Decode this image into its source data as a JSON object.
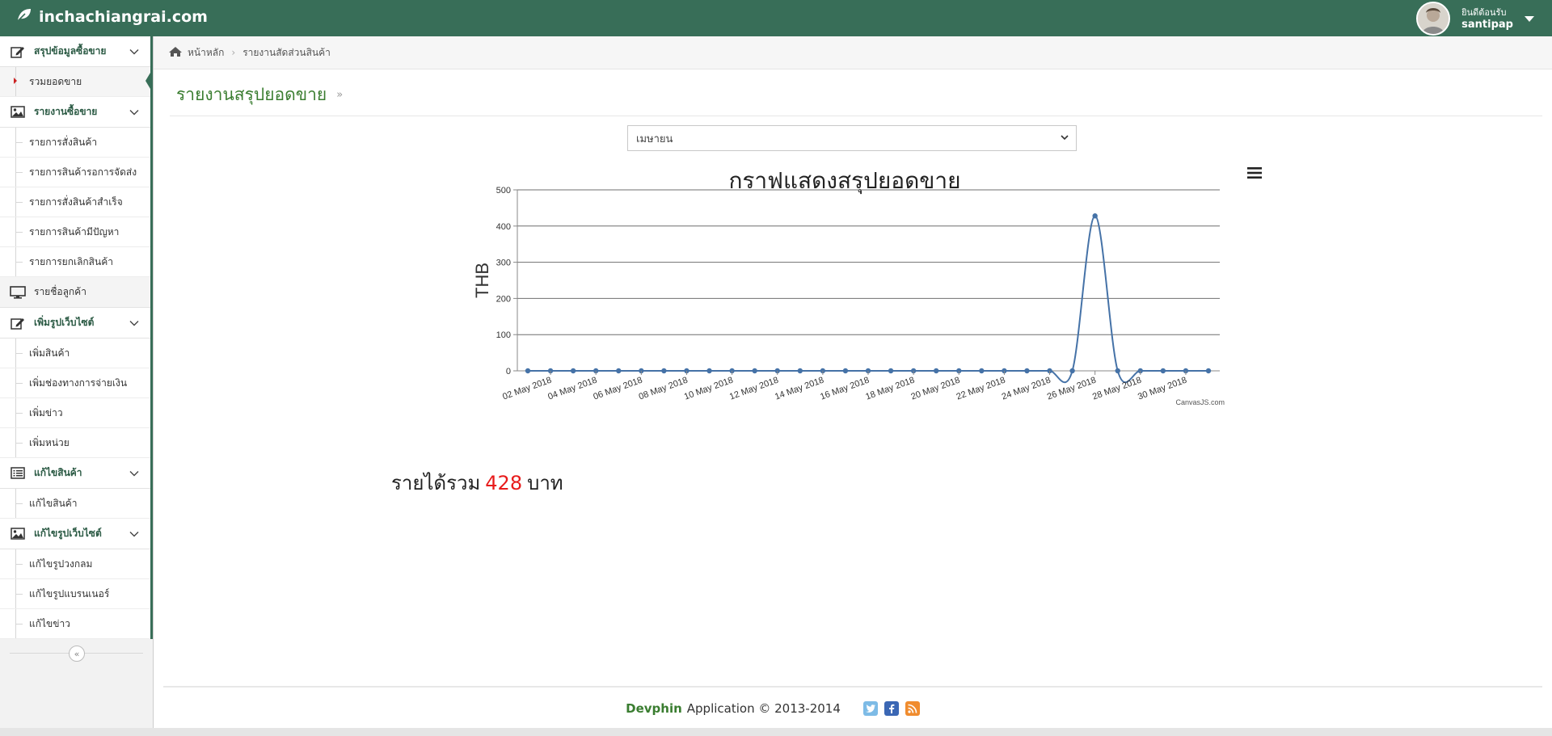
{
  "topbar": {
    "brand": "inchachiangrai.com",
    "welcome": "ยินดีต้อนรับ",
    "username": "santipap"
  },
  "sidebar": {
    "groups": [
      {
        "label": "สรุปข้อมูลซื้อขาย",
        "icon": "edit-icon",
        "items": [
          {
            "label": "รวมยอดขาย",
            "active": true
          }
        ]
      },
      {
        "label": "รายงานซื้อขาย",
        "icon": "image-icon",
        "items": [
          {
            "label": "รายการสั่งสินค้า"
          },
          {
            "label": "รายการสินค้ารอการจัดส่ง"
          },
          {
            "label": "รายการสั่งสินค้าสำเร็จ"
          },
          {
            "label": "รายการสินค้ามีปัญหา"
          },
          {
            "label": "รายการยกเลิกสินค้า"
          }
        ]
      },
      {
        "label": "รายชื่อลูกค้า",
        "icon": "desktop-icon",
        "items": []
      },
      {
        "label": "เพิ่มรูปเว็บไซต์",
        "icon": "edit-icon",
        "items": [
          {
            "label": "เพิ่มสินค้า"
          },
          {
            "label": "เพิ่มช่องทางการจ่ายเงิน"
          },
          {
            "label": "เพิ่มข่าว"
          },
          {
            "label": "เพิ่มหน่วย"
          }
        ]
      },
      {
        "label": "แก้ไขสินค้า",
        "icon": "list-icon",
        "items": [
          {
            "label": "แก้ไขสินค้า"
          }
        ]
      },
      {
        "label": "แก้ไขรูปเว็บไซต์",
        "icon": "image-icon",
        "items": [
          {
            "label": "แก้ไขรูปวงกลม"
          },
          {
            "label": "แก้ไขรูปแบรนเนอร์"
          },
          {
            "label": "แก้ไขข่าว"
          }
        ]
      }
    ],
    "collapse_symbol": "«"
  },
  "breadcrumb": {
    "home": "หน้าหลัก",
    "current": "รายงานสัดส่วนสินค้า"
  },
  "page": {
    "title": "รายงานสรุปยอดขาย",
    "title_suffix": "»",
    "month_select": "เมษายน"
  },
  "revenue": {
    "prefix": "รายได้รวม",
    "value": "428",
    "suffix": "บาท"
  },
  "footer": {
    "brand": "Devphin",
    "text": "Application © 2013-2014"
  },
  "colors": {
    "brand_green": "#386e58",
    "title_green": "#3a7d30",
    "line_blue": "#4572a7",
    "revenue_red": "#e81b1b"
  },
  "chart_data": {
    "type": "line",
    "title": "กราฟแสดงสรุปยอดขาย",
    "ylabel": "THB",
    "xlabel": "",
    "ylim": [
      0,
      500
    ],
    "yticks": [
      0,
      100,
      200,
      300,
      400,
      500
    ],
    "grid": true,
    "credit": "CanvasJS.com",
    "x_tick_labels": [
      "02 May 2018",
      "04 May 2018",
      "06 May 2018",
      "08 May 2018",
      "10 May 2018",
      "12 May 2018",
      "14 May 2018",
      "16 May 2018",
      "18 May 2018",
      "20 May 2018",
      "22 May 2018",
      "24 May 2018",
      "26 May 2018",
      "28 May 2018",
      "30 May 2018"
    ],
    "series": [
      {
        "x": [
          "2018-05-01",
          "2018-05-02",
          "2018-05-03",
          "2018-05-04",
          "2018-05-05",
          "2018-05-06",
          "2018-05-07",
          "2018-05-08",
          "2018-05-09",
          "2018-05-10",
          "2018-05-11",
          "2018-05-12",
          "2018-05-13",
          "2018-05-14",
          "2018-05-15",
          "2018-05-16",
          "2018-05-17",
          "2018-05-18",
          "2018-05-19",
          "2018-05-20",
          "2018-05-21",
          "2018-05-22",
          "2018-05-23",
          "2018-05-24",
          "2018-05-25",
          "2018-05-26",
          "2018-05-27",
          "2018-05-28",
          "2018-05-29",
          "2018-05-30",
          "2018-05-31"
        ],
        "values": [
          0,
          0,
          0,
          0,
          0,
          0,
          0,
          0,
          0,
          0,
          0,
          0,
          0,
          0,
          0,
          0,
          0,
          0,
          0,
          0,
          0,
          0,
          0,
          0,
          0,
          428,
          0,
          0,
          0,
          0,
          0
        ]
      }
    ]
  }
}
